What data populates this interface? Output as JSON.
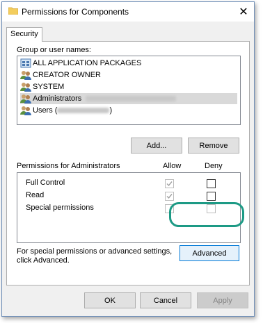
{
  "window": {
    "title": "Permissions for Components"
  },
  "tabs": [
    {
      "label": "Security"
    }
  ],
  "groups": {
    "label": "Group or user names:",
    "items": [
      {
        "name": "ALL APPLICATION PACKAGES",
        "icon": "app-packages-icon"
      },
      {
        "name": "CREATOR OWNER",
        "icon": "users-icon"
      },
      {
        "name": "SYSTEM",
        "icon": "users-icon"
      },
      {
        "name": "Administrators",
        "icon": "users-icon",
        "selected": true
      },
      {
        "name": "Users (",
        "suffix": ")",
        "icon": "users-icon"
      }
    ],
    "add_label": "Add...",
    "remove_label": "Remove"
  },
  "permissions": {
    "header": "Permissions for Administrators",
    "allow_label": "Allow",
    "deny_label": "Deny",
    "rows": [
      {
        "name": "Full Control",
        "allow": true,
        "allow_disabled": true,
        "deny": false
      },
      {
        "name": "Read",
        "allow": true,
        "allow_disabled": true,
        "deny": false
      },
      {
        "name": "Special permissions",
        "allow": false,
        "allow_disabled": true,
        "deny": false,
        "deny_disabled": true
      }
    ]
  },
  "advanced": {
    "text_line1": "For special permissions or advanced settings,",
    "text_line2": "click Advanced.",
    "button_label": "Advanced"
  },
  "footer": {
    "ok_label": "OK",
    "cancel_label": "Cancel",
    "apply_label": "Apply"
  },
  "colors": {
    "highlight": "#1d9a85",
    "selection": "#d9d9d9"
  }
}
